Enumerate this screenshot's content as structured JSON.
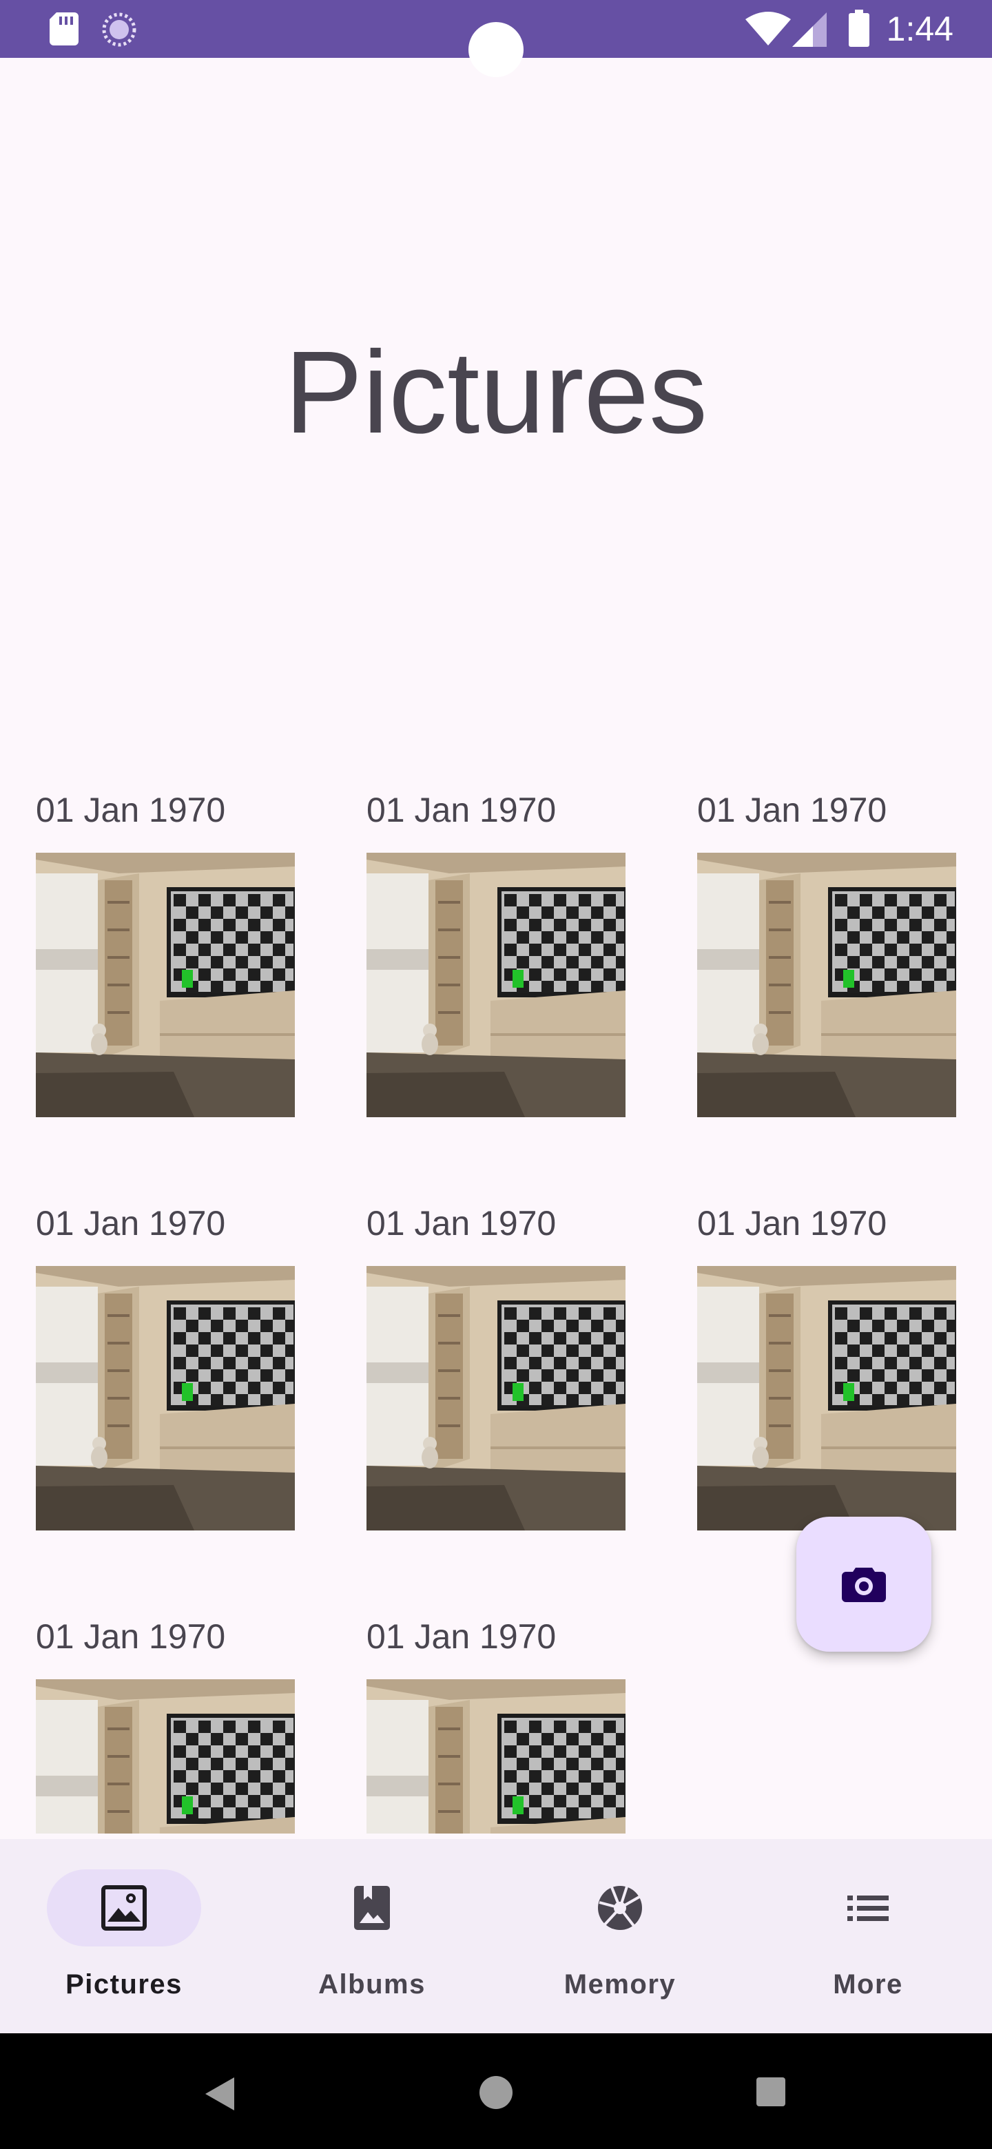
{
  "status_bar": {
    "time": "1:44",
    "color": "#6650A4",
    "icons": [
      "sd-card-icon",
      "sync-icon",
      "wifi-icon",
      "signal-icon",
      "battery-icon"
    ]
  },
  "page": {
    "title": "Pictures"
  },
  "photos": [
    {
      "date": "01 Jan 1970"
    },
    {
      "date": "01 Jan 1970"
    },
    {
      "date": "01 Jan 1970"
    },
    {
      "date": "01 Jan 1970"
    },
    {
      "date": "01 Jan 1970"
    },
    {
      "date": "01 Jan 1970"
    },
    {
      "date": "01 Jan 1970"
    },
    {
      "date": "01 Jan 1970"
    }
  ],
  "fab": {
    "icon": "camera-icon",
    "color": "#EADDFF"
  },
  "bottom_nav": {
    "items": [
      {
        "label": "Pictures",
        "icon": "image-icon",
        "active": true
      },
      {
        "label": "Albums",
        "icon": "album-icon",
        "active": false
      },
      {
        "label": "Memory",
        "icon": "aperture-icon",
        "active": false
      },
      {
        "label": "More",
        "icon": "list-icon",
        "active": false
      }
    ]
  },
  "system_nav": {
    "icons": [
      "back-icon",
      "home-icon",
      "recents-icon"
    ]
  }
}
